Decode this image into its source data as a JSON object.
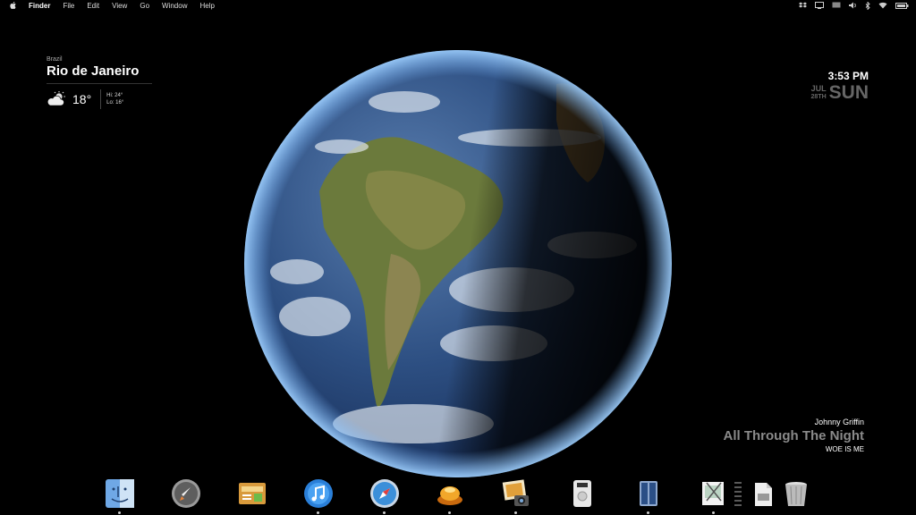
{
  "menubar": {
    "apple_icon": "apple-icon",
    "items": [
      "Finder",
      "File",
      "Edit",
      "View",
      "Go",
      "Window",
      "Help"
    ],
    "status_icons": [
      "dropbox-icon",
      "screen-icon",
      "screen-mirror-icon",
      "volume-icon",
      "bluetooth-icon",
      "wifi-icon",
      "battery-icon"
    ]
  },
  "weather": {
    "country": "Brazil",
    "city": "Rio de Janeiro",
    "temperature": "18°",
    "high": "Hi:  24°",
    "low": "Lo:  16°",
    "icon": "partly-cloudy-icon"
  },
  "clock": {
    "time": "3:53 PM",
    "month": "JUL",
    "day": "28TH",
    "weekday": "SUN"
  },
  "now_playing": {
    "artist": "Johnny Griffin",
    "song": "All Through The Night",
    "album": "WOE IS ME"
  },
  "dock": {
    "items": [
      {
        "name": "finder",
        "icon": "finder-icon",
        "running": true
      },
      {
        "name": "launchpad",
        "icon": "launchpad-icon",
        "running": false
      },
      {
        "name": "system-utility",
        "icon": "utility-icon",
        "running": false
      },
      {
        "name": "itunes",
        "icon": "itunes-icon",
        "running": true
      },
      {
        "name": "safari",
        "icon": "safari-icon",
        "running": true
      },
      {
        "name": "growl",
        "icon": "lamp-icon",
        "running": true
      },
      {
        "name": "iphoto",
        "icon": "iphoto-icon",
        "running": true
      },
      {
        "name": "dvd-player",
        "icon": "dvd-player-icon",
        "running": false
      },
      {
        "name": "columns-app",
        "icon": "columns-icon",
        "running": true
      },
      {
        "name": "preview",
        "icon": "preview-icon",
        "running": true
      },
      {
        "name": "document-stack",
        "icon": "document-icon",
        "running": false
      },
      {
        "name": "trash",
        "icon": "trash-icon",
        "running": false
      }
    ]
  }
}
